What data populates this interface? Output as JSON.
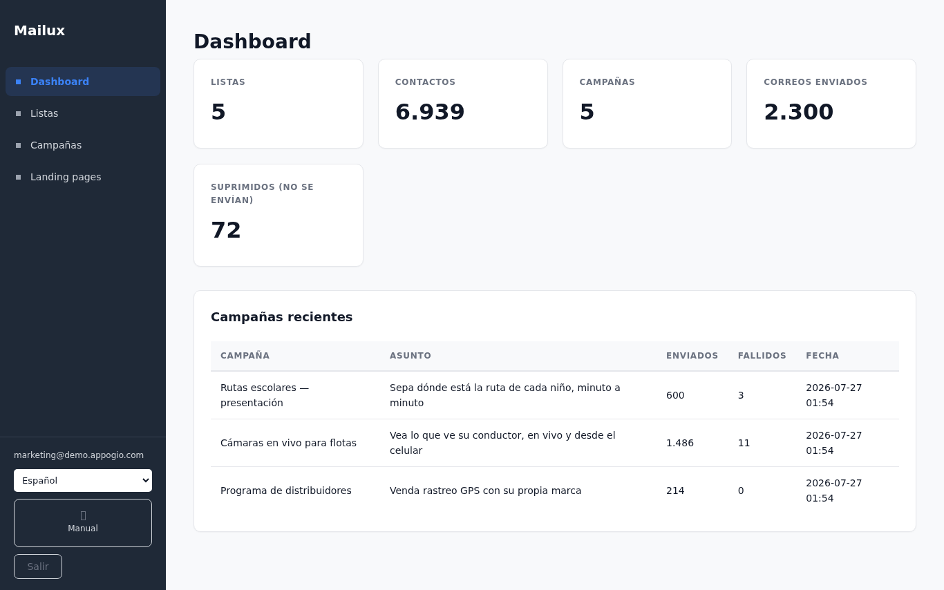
{
  "sidebar": {
    "brand": "Mailux",
    "items": [
      {
        "label": "Dashboard",
        "selected": true
      },
      {
        "label": "Listas",
        "selected": false
      },
      {
        "label": "Campañas",
        "selected": false
      },
      {
        "label": "Landing pages",
        "selected": false
      }
    ],
    "user_email": "marketing@demo.appogio.com",
    "language_select": {
      "value": "Español"
    },
    "manual_button": {
      "label": "Manual"
    },
    "logout_button": {
      "label": "Salir"
    }
  },
  "page_title": "Dashboard",
  "stats": [
    {
      "label": "LISTAS",
      "value": "5"
    },
    {
      "label": "CONTACTOS",
      "value": "6.939"
    },
    {
      "label": "CAMPAÑAS",
      "value": "5"
    },
    {
      "label": "CORREOS ENVIADOS",
      "value": "2.300"
    },
    {
      "label": "SUPRIMIDOS (NO SE ENVÍAN)",
      "value": "72"
    }
  ],
  "recent_campaigns": {
    "title": "Campañas recientes",
    "columns": [
      "CAMPAÑA",
      "ASUNTO",
      "ENVIADOS",
      "FALLIDOS",
      "FECHA"
    ],
    "rows": [
      [
        "Rutas escolares — presentación",
        "Sepa dónde está la ruta de cada niño, minuto a minuto",
        "600",
        "3",
        "2026-07-27 01:54"
      ],
      [
        "Cámaras en vivo para flotas",
        "Vea lo que ve su conductor, en vivo y desde el celular",
        "1.486",
        "11",
        "2026-07-27 01:54"
      ],
      [
        "Programa de distribuidores",
        "Venda rastreo GPS con su propia marca",
        "214",
        "0",
        "2026-07-27 01:54"
      ]
    ]
  }
}
